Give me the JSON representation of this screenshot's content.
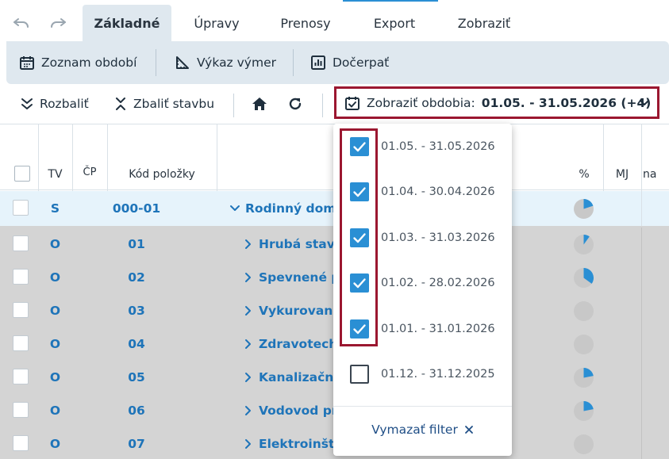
{
  "history": {
    "undo_icon": "undo-icon",
    "redo_icon": "redo-icon"
  },
  "tabs": [
    {
      "label": "Základné",
      "active": true
    },
    {
      "label": "Úpravy"
    },
    {
      "label": "Prenosy"
    },
    {
      "label": "Export"
    },
    {
      "label": "Zobraziť"
    }
  ],
  "ribbon": {
    "periods_list": "Zoznam období",
    "measurements": "Výkaz výmer",
    "draw": "Dočerpať"
  },
  "toolbar": {
    "expand": "Rozbaliť",
    "collapse": "Zbaliť stavbu",
    "period_prefix": "Zobraziť obdobia:",
    "period_value": "01.05. - 31.05.2026 (+4)"
  },
  "table": {
    "headers": {
      "tv": "TV",
      "cp": "ČP",
      "code": "Kód položky",
      "percent": "%",
      "unit": "MJ",
      "extra": "na"
    },
    "header_row": {
      "tv": "S",
      "code": "000-01",
      "name": "Rodinný dom",
      "progress": 0.2
    },
    "rows": [
      {
        "tv": "O",
        "code": "01",
        "name": "Hrubá stav",
        "progress": 0.1
      },
      {
        "tv": "O",
        "code": "02",
        "name": "Spevnené p",
        "progress": 0.35
      },
      {
        "tv": "O",
        "code": "03",
        "name": "Vykurovani",
        "progress": 0
      },
      {
        "tv": "O",
        "code": "04",
        "name": "Zdravotech",
        "progress": 0
      },
      {
        "tv": "O",
        "code": "05",
        "name": "Kanalizačn",
        "progress": 0.22
      },
      {
        "tv": "O",
        "code": "06",
        "name": "Vodovod pr",
        "progress": 0.22
      },
      {
        "tv": "O",
        "code": "07",
        "name": "Elektroinšt",
        "progress": 0
      }
    ]
  },
  "dropdown": {
    "items": [
      {
        "label": "01.05. - 31.05.2026",
        "checked": true
      },
      {
        "label": "01.04. - 30.04.2026",
        "checked": true
      },
      {
        "label": "01.03. - 31.03.2026",
        "checked": true
      },
      {
        "label": "01.02. - 28.02.2026",
        "checked": true
      },
      {
        "label": "01.01. - 31.01.2026",
        "checked": true
      },
      {
        "label": "01.12. - 31.12.2025",
        "checked": false
      }
    ],
    "clear_label": "Vymazať filter"
  },
  "colors": {
    "accent": "#2a8fd4",
    "highlight": "#9b1730",
    "link": "#1e74b9",
    "pie_fill": "#2a8fd4",
    "pie_bg": "#c8c8c8"
  }
}
